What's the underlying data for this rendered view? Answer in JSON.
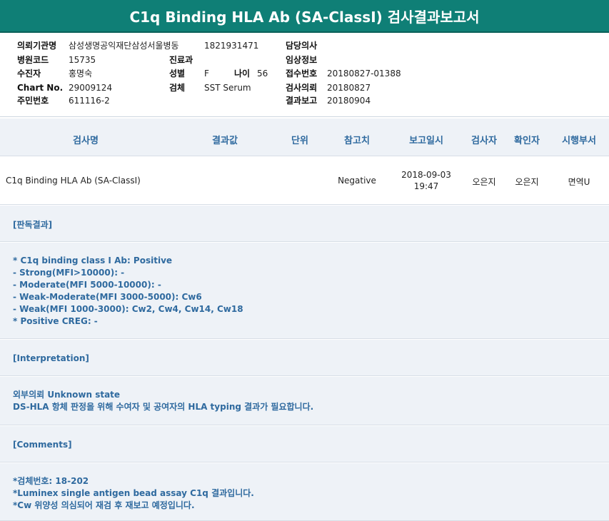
{
  "report": {
    "title": "C1q Binding HLA Ab (SA-ClassI) 검사결과보고서"
  },
  "patient_info": {
    "institution_label": "의뢰기관명",
    "institution_value": "삼성생명공익재단삼성서울병동",
    "institution_code": "1821931471",
    "doctor_label": "담당의사",
    "hospital_code_label": "병원코드",
    "hospital_code_value": "15735",
    "department_label": "진료과",
    "clinical_info_label": "임상정보",
    "collector_label": "수진자",
    "collector_value": "홍명숙",
    "sex_label": "성별",
    "sex_value": "F",
    "age_label": "나이",
    "age_value": "56",
    "receipt_no_label": "접수번호",
    "receipt_no_value": "20180827-01388",
    "chart_no_label": "Chart No.",
    "chart_no_value": "29009124",
    "specimen_label": "검체",
    "specimen_value": "SST Serum",
    "request_label": "검사의뢰",
    "request_value": "20180827",
    "id_label": "주민번호",
    "id_value": "611116-2",
    "report_label": "결과보고",
    "report_value": "20180904"
  },
  "table": {
    "headers": [
      "검사명",
      "결과값",
      "단위",
      "참고치",
      "보고일시",
      "검사자",
      "확인자",
      "시행부서"
    ],
    "row": {
      "test_name": "C1q Binding HLA Ab (SA-ClassI)",
      "result": "",
      "unit": "",
      "reference": "Negative",
      "report_date": "2018-09-03",
      "report_time": "19:47",
      "tester": "오은지",
      "confirmer": "오은지",
      "department": "면역U"
    }
  },
  "sections": {
    "interpretation_result_title": "[판독결과]",
    "interpretation_result_lines": [
      "* C1q binding class I Ab: Positive",
      "- Strong(MFI>10000): -",
      "- Moderate(MFI 5000-10000): -",
      "- Weak-Moderate(MFI 3000-5000): Cw6",
      "- Weak(MFI 1000-3000): Cw2, Cw4, Cw14, Cw18",
      "* Positive CREG: -"
    ],
    "interpretation_title": "[Interpretation]",
    "interpretation_lines": [
      "외부의뢰 Unknown state",
      "DS-HLA 항체 판정을 위해 수여자 및 공여자의 HLA typing 결과가 필요합니다."
    ],
    "comments_title": "[Comments]",
    "comments_lines": [
      "*검체번호: 18-202",
      "*Luminex single antigen bead assay C1q 결과입니다.",
      "*Cw 위양성 의심되어 재검 후 재보고 예정입니다."
    ]
  },
  "colors": {
    "header_bg": "#0f7f76",
    "section_bg": "#eef2f7",
    "accent_text": "#2f6a9f"
  }
}
